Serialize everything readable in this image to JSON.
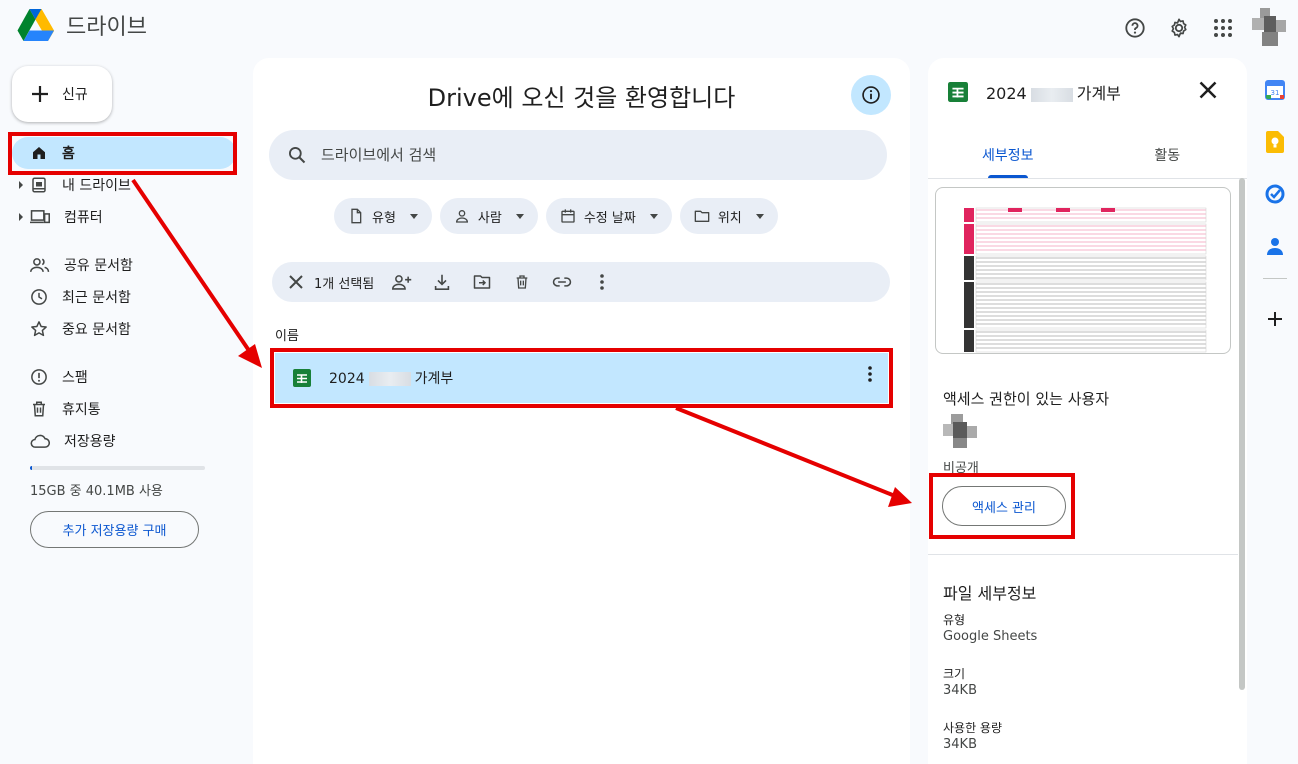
{
  "app": {
    "title": "드라이브"
  },
  "new_button": {
    "label": "신규"
  },
  "sidebar": {
    "items": [
      {
        "label": "홈",
        "icon": "home-icon",
        "active": true
      },
      {
        "label": "내 드라이브",
        "icon": "my-drive-icon",
        "caret": true
      },
      {
        "label": "컴퓨터",
        "icon": "computer-icon",
        "caret": true
      },
      {
        "label": "공유 문서함",
        "icon": "shared-icon"
      },
      {
        "label": "최근 문서함",
        "icon": "clock-icon"
      },
      {
        "label": "중요 문서함",
        "icon": "star-icon"
      },
      {
        "label": "스팸",
        "icon": "spam-icon"
      },
      {
        "label": "휴지통",
        "icon": "trash-icon"
      },
      {
        "label": "저장용량",
        "icon": "cloud-icon"
      }
    ],
    "storage": {
      "text": "15GB 중 40.1MB 사용",
      "used_fraction": 0.01
    },
    "buy_storage_label": "추가 저장용량 구매"
  },
  "main": {
    "welcome": "Drive에 오신 것을 환영합니다",
    "search_placeholder": "드라이브에서 검색",
    "filters": [
      {
        "label": "유형",
        "icon": "file-icon"
      },
      {
        "label": "사람",
        "icon": "person-icon"
      },
      {
        "label": "수정 날짜",
        "icon": "calendar-icon"
      },
      {
        "label": "위치",
        "icon": "folder-icon"
      }
    ],
    "selection": {
      "count_label": "1개 선택됨"
    },
    "column_header": "이름",
    "file": {
      "name_prefix": "2024",
      "name_suffix": "가계부"
    }
  },
  "details": {
    "title_prefix": "2024",
    "title_suffix": "가계부",
    "tabs": [
      "세부정보",
      "활동"
    ],
    "access_heading": "액세스 권한이 있는 사용자",
    "access_status": "비공개",
    "manage_access_label": "액세스 관리",
    "file_details_heading": "파일 세부정보",
    "props": [
      {
        "label": "유형",
        "value": "Google Sheets"
      },
      {
        "label": "크기",
        "value": "34KB"
      },
      {
        "label": "사용한 용량",
        "value": "34KB"
      }
    ]
  },
  "colors": {
    "accent": "#0b57d0",
    "selected": "#c2e7ff",
    "sheets_green": "#188038",
    "annotation_red": "#e50000"
  }
}
